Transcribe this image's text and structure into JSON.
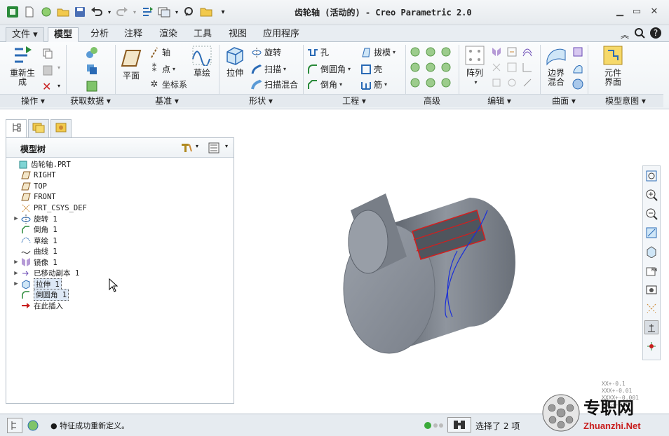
{
  "window": {
    "title": "齿轮轴 (活动的) - Creo Parametric 2.0"
  },
  "quick_access": [
    "app-icon",
    "new-icon",
    "open-session-icon",
    "open-icon",
    "save-icon",
    "undo-icon",
    "redo-icon",
    "regenerate-icon",
    "window-icon",
    "find-icon",
    "folder-icon",
    "customize-icon"
  ],
  "tabs": [
    "文件",
    "模型",
    "分析",
    "注释",
    "渲染",
    "工具",
    "视图",
    "应用程序"
  ],
  "active_tab": "模型",
  "ribbon": {
    "operations": {
      "regen": "重新生成",
      "footer": "操作"
    },
    "get_data": {
      "footer": "获取数据"
    },
    "datum": {
      "plane": "平面",
      "axis": "轴",
      "point": "点",
      "csys": "坐标系",
      "sketch": "草绘",
      "footer": "基准"
    },
    "shapes": {
      "extrude": "拉伸",
      "revolve": "旋转",
      "sweep": "扫描",
      "swept_blend": "扫描混合",
      "footer": "形状"
    },
    "engineering": {
      "hole": "孔",
      "draft": "拔模",
      "round": "倒圆角",
      "shell": "壳",
      "chamfer": "倒角",
      "rib": "筋",
      "footer": "工程"
    },
    "advanced": {
      "footer": "高级"
    },
    "editing": {
      "pattern": "阵列",
      "footer": "编辑"
    },
    "surfaces": {
      "boundary_blend": "边界混合",
      "footer": "曲面"
    },
    "model_intent": {
      "component_interface": "元件界面",
      "footer": "模型意图"
    }
  },
  "model_tree": {
    "title": "模型树",
    "items": [
      {
        "label": "齿轮轴.PRT",
        "icon": "part-icon",
        "expander": ""
      },
      {
        "label": "RIGHT",
        "icon": "datum-plane-icon",
        "expander": ""
      },
      {
        "label": "TOP",
        "icon": "datum-plane-icon",
        "expander": ""
      },
      {
        "label": "FRONT",
        "icon": "datum-plane-icon",
        "expander": ""
      },
      {
        "label": "PRT_CSYS_DEF",
        "icon": "csys-icon",
        "expander": ""
      },
      {
        "label": "旋转 1",
        "icon": "revolve-icon",
        "expander": "▶"
      },
      {
        "label": "倒角 1",
        "icon": "chamfer-icon",
        "expander": ""
      },
      {
        "label": "草绘 1",
        "icon": "sketch-icon",
        "expander": ""
      },
      {
        "label": "曲线 1",
        "icon": "curve-icon",
        "expander": ""
      },
      {
        "label": "镜像 1",
        "icon": "mirror-icon",
        "expander": "▶"
      },
      {
        "label": "已移动副本 1",
        "icon": "moved-copy-icon",
        "expander": "▶"
      },
      {
        "label": "拉伸 1",
        "icon": "extrude-icon",
        "expander": "▶"
      },
      {
        "label": "倒圆角 1",
        "icon": "round-icon",
        "expander": ""
      },
      {
        "label": "在此插入",
        "icon": "insert-here-icon",
        "expander": ""
      }
    ],
    "selected": [
      "拉伸 1",
      "倒圆角 1"
    ]
  },
  "status": {
    "message": "● 特征成功重新定义。",
    "selection": "选择了 2 项",
    "tolerance": [
      "XX+-0.1",
      "XXX+-0.01",
      "XXXX+-0.001",
      "ANG+-0.5"
    ]
  },
  "watermark": {
    "text": "专职网",
    "url": "Zhuanzhi.Net"
  },
  "colors": {
    "model_gray": "#7d838d",
    "highlight_red": "#d21e1e",
    "curve_blue": "#1a2fd8"
  }
}
